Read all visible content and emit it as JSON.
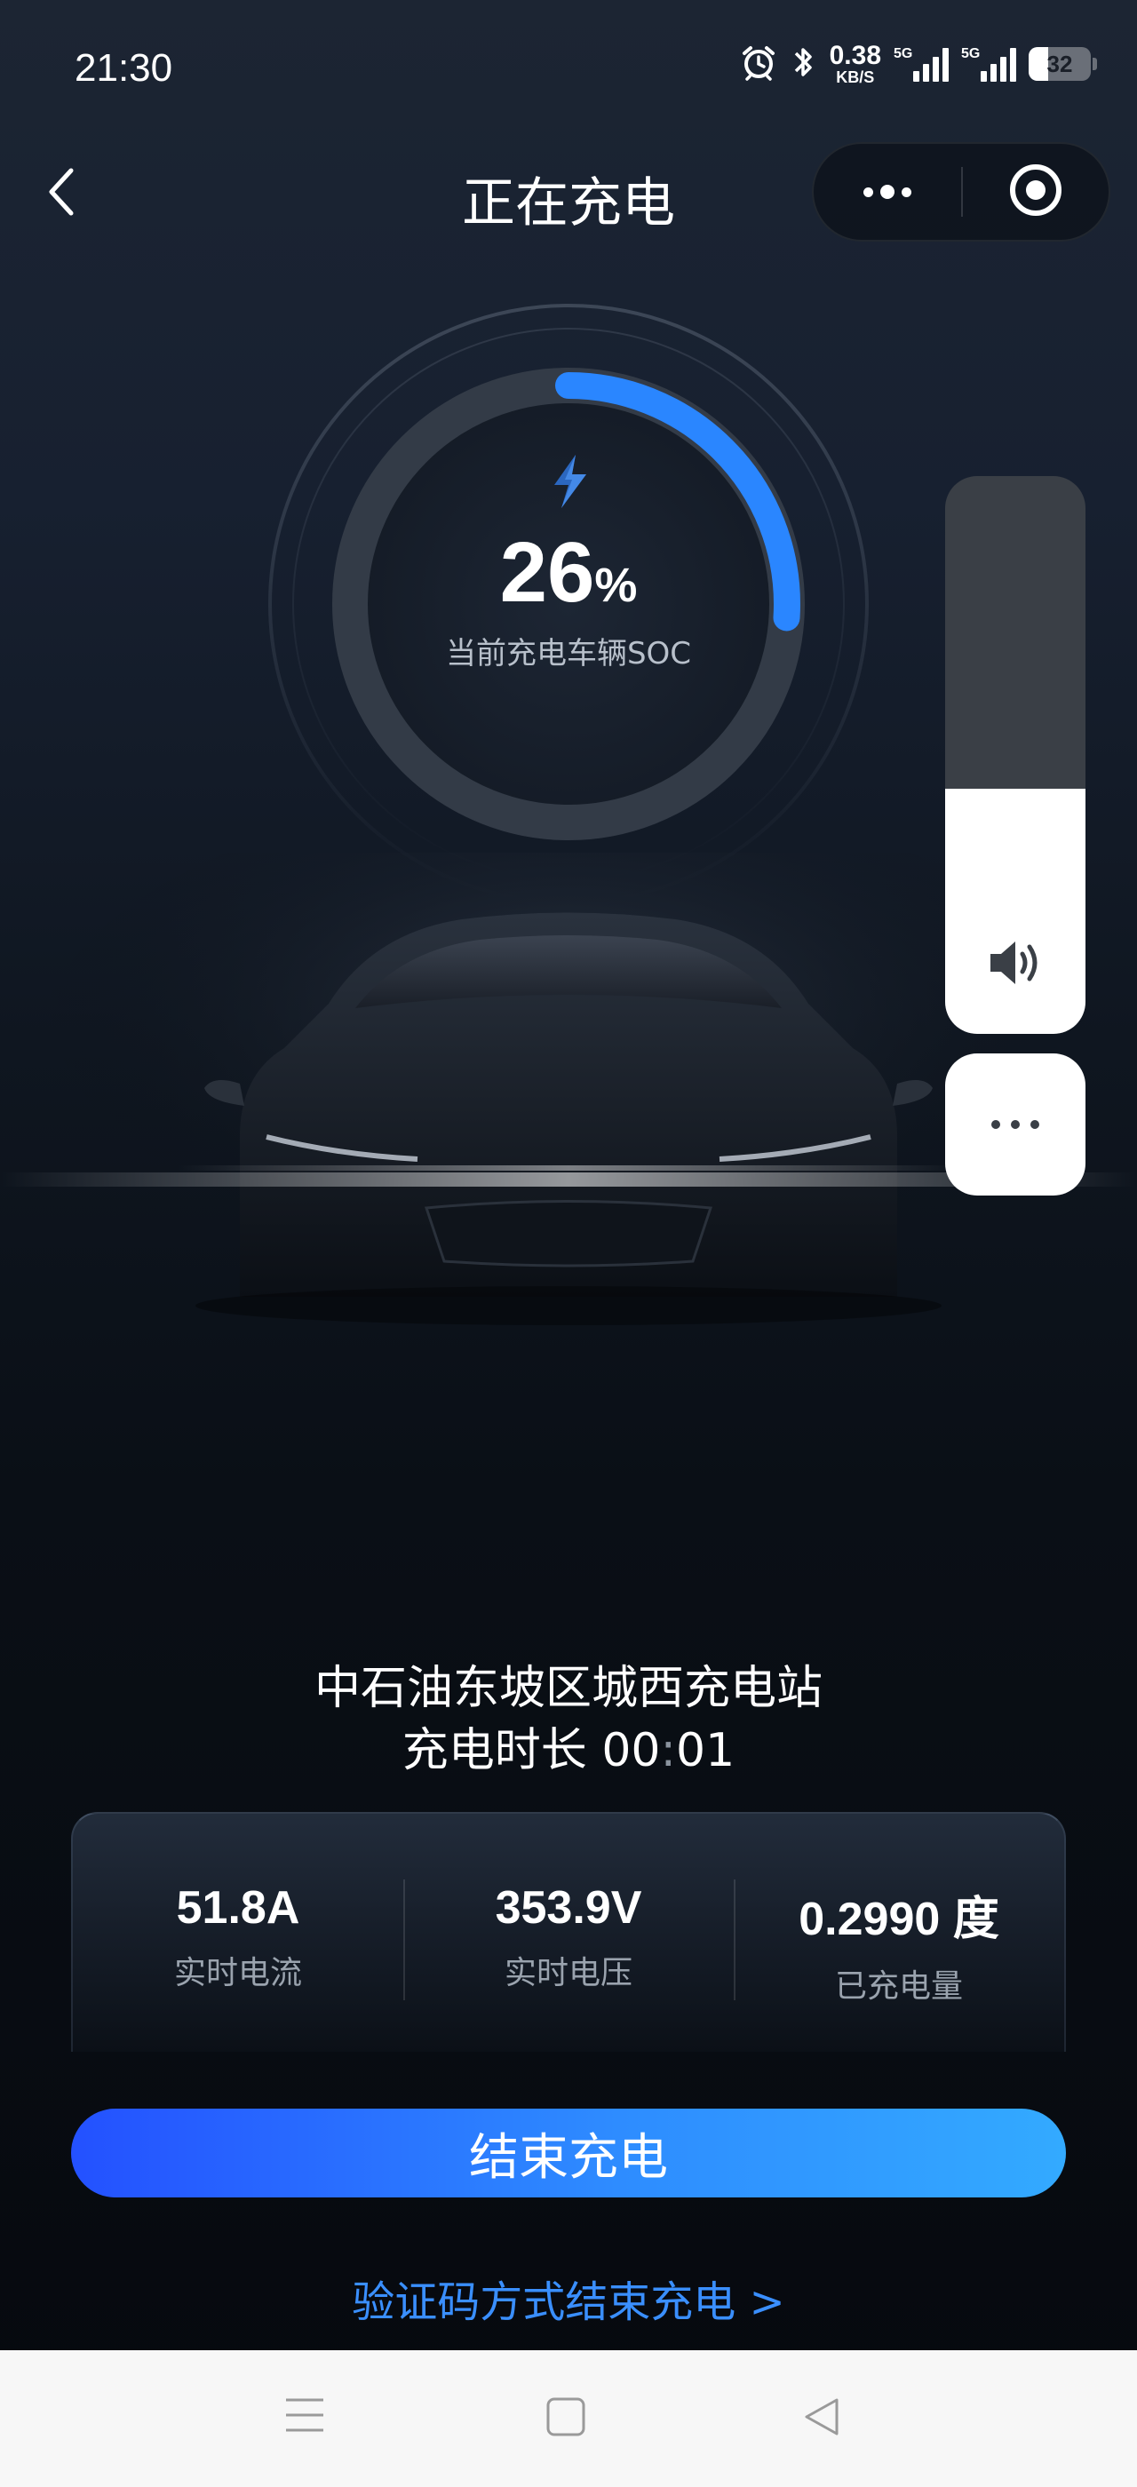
{
  "status_bar": {
    "time": "21:30",
    "net_speed_value": "0.38",
    "net_speed_unit": "KB/S",
    "signal1_tag": "5G",
    "signal2_tag": "5G",
    "battery": "32",
    "icons": [
      "alarm-icon",
      "bluetooth-icon",
      "signal-icon",
      "battery-icon"
    ]
  },
  "header": {
    "title": "正在充电",
    "icons": [
      "back-arrow-icon",
      "more-dots-icon",
      "target-icon"
    ]
  },
  "gauge": {
    "soc_value": "26",
    "soc_unit": "%",
    "soc_fraction": 0.26,
    "label": "当前充电车辆SOC",
    "progress_color": "#2a86ff"
  },
  "floating_panel": {
    "volume_level": 0.44,
    "icons": [
      "volume-icon",
      "more-dots-icon"
    ]
  },
  "station": {
    "name": "中石油东坡区城西充电站",
    "duration_label": "充电时长",
    "duration_hours": "00",
    "duration_sep": ":",
    "duration_minutes": "01"
  },
  "stats": [
    {
      "value": "51.8A",
      "label": "实时电流"
    },
    {
      "value": "353.9V",
      "label": "实时电压"
    },
    {
      "value": "0.2990 度",
      "label": "已充电量"
    }
  ],
  "actions": {
    "end_button": "结束充电",
    "verify_link": "验证码方式结束充电 >"
  },
  "system_nav": {
    "icons": [
      "menu-icon",
      "home-square-icon",
      "back-triangle-icon"
    ]
  },
  "colors": {
    "accent_blue": "#2e8cff",
    "link_blue": "#3a8fff",
    "background_top": "#1c2533",
    "background_bottom": "#06090e"
  }
}
